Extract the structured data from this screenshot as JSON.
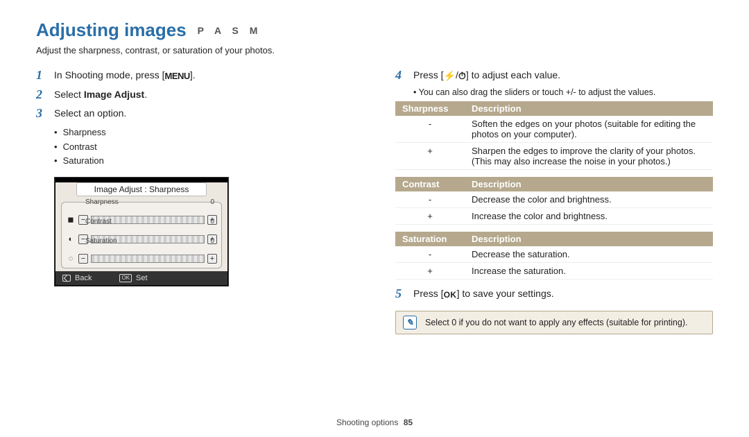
{
  "heading": "Adjusting images",
  "modes": "P A S M",
  "intro": "Adjust the sharpness, contrast, or saturation of your photos.",
  "left": {
    "step1_num": "1",
    "step1_pre": "In Shooting mode, press [",
    "step1_glyph": "MENU",
    "step1_post": "].",
    "step2_num": "2",
    "step2_pre": "Select ",
    "step2_kw": "Image Adjust",
    "step2_post": ".",
    "step3_num": "3",
    "step3_text": "Select an option.",
    "bullets": [
      "Sharpness",
      "Contrast",
      "Saturation"
    ],
    "shot": {
      "title": "Image Adjust : Sharpness",
      "rows": [
        {
          "icon": "◼",
          "label": "Sharpness",
          "value": "0"
        },
        {
          "icon": "◐",
          "label": "Contrast",
          "value": "0"
        },
        {
          "icon": "◌",
          "label": "Saturation",
          "value": "0"
        }
      ],
      "back_label": "Back",
      "set_label": "Set",
      "ok_icon_text": "OK"
    }
  },
  "right": {
    "step4_num": "4",
    "step4_pre": "Press [",
    "step4_glyph_a": "⚡",
    "step4_sep": "/",
    "step4_glyph_b": "⏱",
    "step4_post": "] to adjust each value.",
    "tip4": "You can also drag the sliders or touch +/- to adjust the values.",
    "tables": {
      "sharpness": {
        "head_a": "Sharpness",
        "head_b": "Description",
        "rows": [
          {
            "sign": "-",
            "desc": "Soften the edges on your photos (suitable for editing the photos on your computer)."
          },
          {
            "sign": "+",
            "desc": "Sharpen the edges to improve the clarity of your photos. (This may also increase the noise in your photos.)"
          }
        ]
      },
      "contrast": {
        "head_a": "Contrast",
        "head_b": "Description",
        "rows": [
          {
            "sign": "-",
            "desc": "Decrease the color and brightness."
          },
          {
            "sign": "+",
            "desc": "Increase the color and brightness."
          }
        ]
      },
      "saturation": {
        "head_a": "Saturation",
        "head_b": "Description",
        "rows": [
          {
            "sign": "-",
            "desc": "Decrease the saturation."
          },
          {
            "sign": "+",
            "desc": "Increase the saturation."
          }
        ]
      }
    },
    "step5_num": "5",
    "step5_pre": "Press [",
    "step5_glyph": "OK",
    "step5_post": "] to save your settings.",
    "note": "Select 0 if you do not want to apply any effects (suitable for printing)."
  },
  "footer_section": "Shooting options",
  "footer_page": "85"
}
